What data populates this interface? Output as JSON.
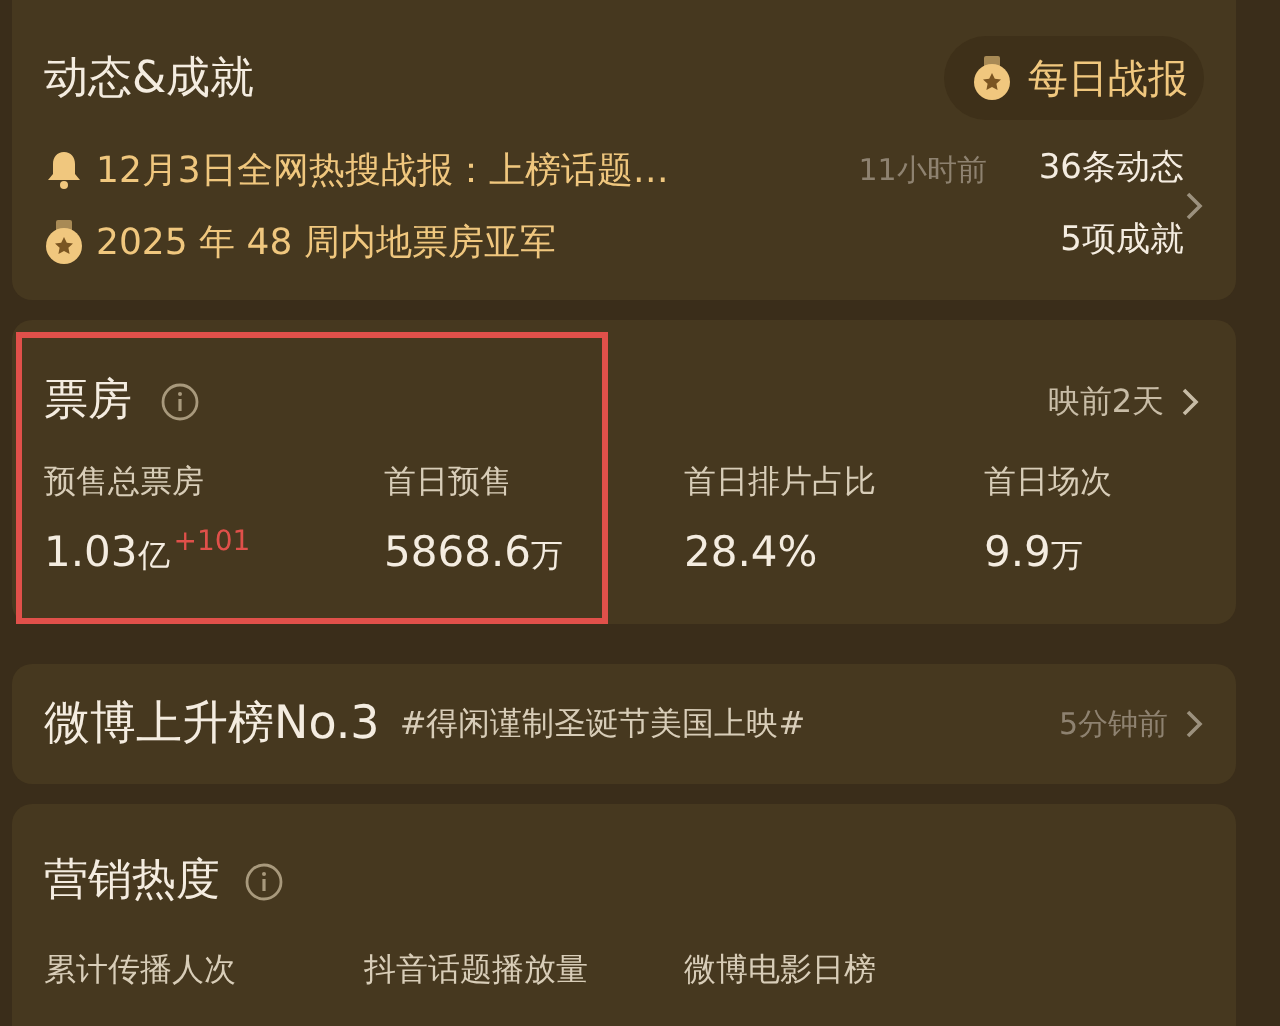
{
  "dynamics": {
    "title": "动态&成就",
    "daily_button": "每日战报",
    "rows": [
      {
        "kind": "news",
        "text": "12月3日全网热搜战报：上榜话题…",
        "time": "11小时前",
        "count_num": "36",
        "count_unit": "条动态"
      },
      {
        "kind": "medal",
        "text": "2025 年 48 周内地票房亚军",
        "count_num": "5",
        "count_unit": "项成就"
      }
    ]
  },
  "box_office": {
    "title": "票房",
    "link": "映前2天",
    "highlighted": true,
    "stats": [
      {
        "label": "预售总票房",
        "value": "1.03",
        "unit": "亿",
        "delta": "+101"
      },
      {
        "label": "首日预售",
        "value": "5868.6",
        "unit": "万"
      },
      {
        "label": "首日排片占比",
        "value": "28.4%"
      },
      {
        "label": "首日场次",
        "value": "9.9",
        "unit": "万"
      }
    ]
  },
  "weibo": {
    "title": "微博上升榜No.3",
    "tag": "#得闲谨制圣诞节美国上映#",
    "time": "5分钟前"
  },
  "marketing": {
    "title": "营销热度",
    "labels": [
      "累计传播人次",
      "抖音话题播放量",
      "微博电影日榜"
    ]
  }
}
